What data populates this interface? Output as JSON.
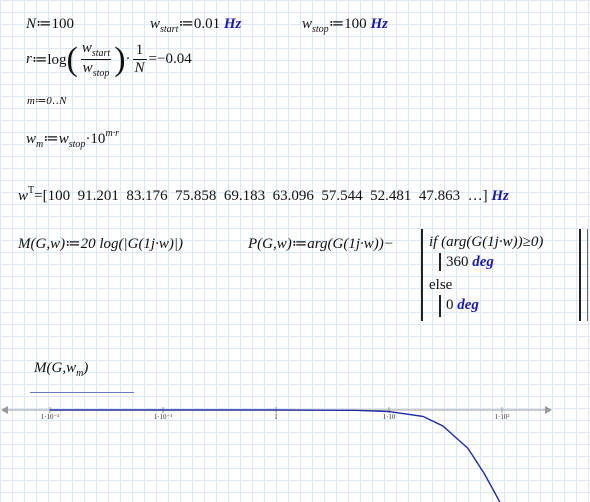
{
  "defs": {
    "N_name": "N",
    "N_assign": "≔100",
    "wstart_name": "w",
    "wstart_sub": "start",
    "wstart_assign": "≔0.01",
    "wstart_unit": "Hz",
    "wstop_name": "w",
    "wstop_sub": "stop",
    "wstop_assign": "≔100",
    "wstop_unit": "Hz"
  },
  "r_expr": {
    "lhs": "r",
    "assign": "≔log",
    "num": "w",
    "num_sub": "start",
    "den": "w",
    "den_sub": "stop",
    "dot": "·",
    "frac2_num": "1",
    "frac2_den": "N",
    "result": "=−0.04"
  },
  "range": {
    "text": "m≔0‥N"
  },
  "wm_expr": {
    "lhs": "w",
    "lhs_sub": "m",
    "assign": "≔",
    "rhs": "w",
    "rhs_sub": "stop",
    "rest": "·10",
    "exp": "m·r"
  },
  "transpose": {
    "lhs": "w",
    "sup": "T",
    "values": "=[100  91.201  83.176  75.858  69.183  63.096  57.544  52.481  47.863  …]",
    "unit": "Hz"
  },
  "functions": {
    "M_def": "M(G,w)≔20 log(|G(1j·w)|)",
    "P_def": "P(G,w)≔arg(G(1j·w))−",
    "if_line": "if (arg(G(1j·w))≥0)",
    "then_val": "360",
    "then_unit": "deg",
    "else_label": "else",
    "else_val": "0",
    "else_unit": "deg"
  },
  "plot": {
    "y_label": "M(G,w",
    "y_label_sub": "m",
    "y_label_close": ")",
    "x_ticks": [
      "1·10⁻²",
      "1·10⁻¹",
      "1",
      "1·10",
      "1·10²"
    ],
    "curve_color": "#1f2a9e",
    "axis_color": "#999999"
  },
  "chart_data": {
    "type": "line",
    "title": "",
    "xlabel": "",
    "ylabel": "M(G,w_m)",
    "x_scale": "log",
    "xlim": [
      0.01,
      100
    ],
    "x_tick_labels": [
      "1·10⁻²",
      "1·10⁻¹",
      "1",
      "1·10",
      "1·10²"
    ],
    "grid": false,
    "series": [
      {
        "x": [
          0.01,
          0.1,
          1,
          5,
          10,
          20,
          30,
          50,
          70,
          100
        ],
        "y": [
          0,
          0,
          0,
          -0.1,
          -0.5,
          -2,
          -5,
          -12,
          -20,
          -30
        ]
      }
    ]
  }
}
